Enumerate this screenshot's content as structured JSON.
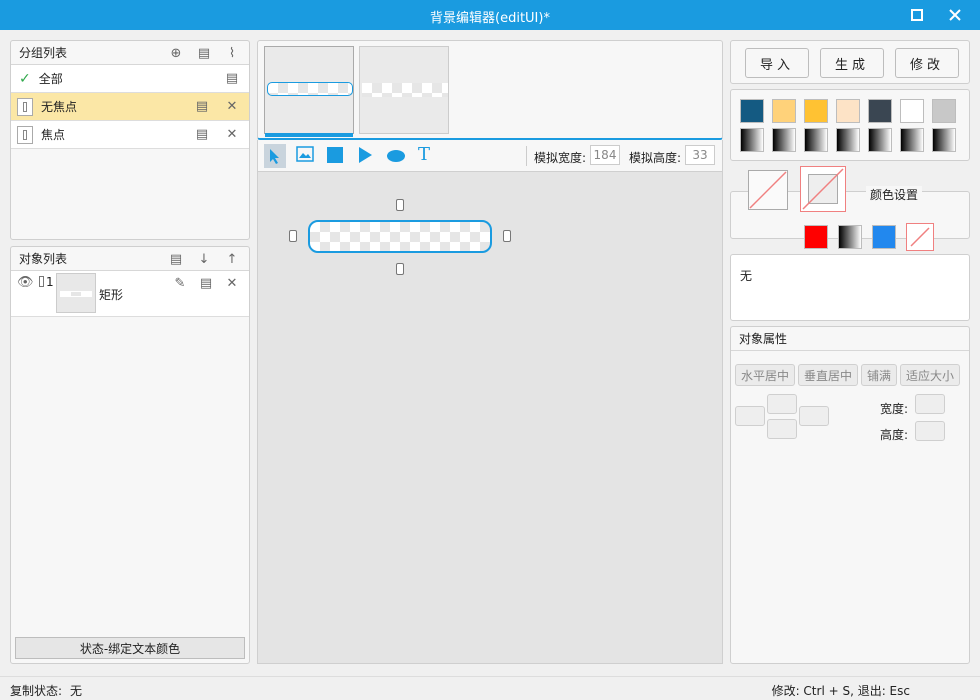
{
  "window": {
    "title": "背景编辑器(editUI)*"
  },
  "group_list": {
    "title": "分组列表",
    "items": [
      {
        "label": "全部",
        "state": "checked"
      },
      {
        "label": "无焦点",
        "state": "selected"
      },
      {
        "label": "焦点",
        "state": "normal"
      }
    ],
    "status_button": "状态-绑定文本颜色"
  },
  "object_list": {
    "title": "对象列表",
    "items": [
      {
        "index": "1",
        "label": "矩形"
      }
    ]
  },
  "canvas": {
    "sim_width_label": "模拟宽度:",
    "sim_width_value": "184",
    "sim_height_label": "模拟高度:",
    "sim_height_value": "33"
  },
  "actions": {
    "import": "导入",
    "generate": "生成",
    "modify": "修改"
  },
  "colors": {
    "row1": [
      "#145a82",
      "#ffd27a",
      "#ffc233",
      "#fde3c6",
      "#3a4652",
      "#ffffff",
      "#c8c8c8"
    ],
    "color_setting_label": "颜色设置",
    "quick": [
      "#ff0000",
      "gradient",
      "#2288ee",
      "none"
    ]
  },
  "text_box": {
    "value": "无"
  },
  "properties": {
    "title": "对象属性",
    "buttons": [
      "水平居中",
      "垂直居中",
      "铺满",
      "适应大小"
    ],
    "width_label": "宽度:",
    "height_label": "高度:"
  },
  "status_bar": {
    "copy_state_label": "复制状态:",
    "copy_state_value": "无",
    "hint": "修改: Ctrl + S, 退出: Esc"
  }
}
